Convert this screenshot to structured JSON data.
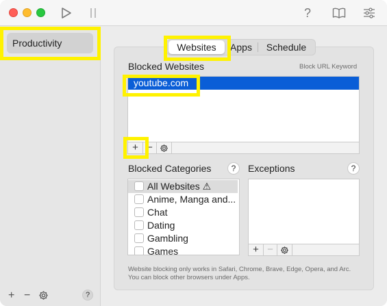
{
  "titlebar": {
    "icons": [
      "play-icon",
      "pause-icon",
      "help-icon",
      "book-icon",
      "sliders-icon"
    ],
    "help_glyph": "?"
  },
  "sidebar": {
    "items": [
      {
        "label": "Productivity"
      }
    ],
    "footer": {
      "add": "+",
      "remove": "−",
      "help": "?"
    }
  },
  "tabs": [
    {
      "label": "Websites",
      "active": true
    },
    {
      "label": "Apps",
      "active": false
    },
    {
      "label": "Schedule",
      "active": false
    }
  ],
  "blocked_websites": {
    "title": "Blocked Websites",
    "keyword_link": "Block URL Keyword",
    "items": [
      "youtube.com"
    ],
    "toolbar": {
      "add": "+",
      "remove": "−"
    }
  },
  "blocked_categories": {
    "title": "Blocked Categories",
    "help": "?",
    "items": [
      {
        "label": "All Websites ⚠",
        "checked": false
      },
      {
        "label": "Anime, Manga and...",
        "checked": false
      },
      {
        "label": "Chat",
        "checked": false
      },
      {
        "label": "Dating",
        "checked": false
      },
      {
        "label": "Gambling",
        "checked": false
      },
      {
        "label": "Games",
        "checked": false
      }
    ]
  },
  "exceptions": {
    "title": "Exceptions",
    "help": "?",
    "toolbar": {
      "add": "+",
      "remove": "−"
    }
  },
  "footnote": {
    "line1": "Website blocking only works in Safari, Chrome, Brave, Edge, Opera, and Arc.",
    "line2": "You can block other browsers under Apps."
  },
  "colors": {
    "selection": "#0a5ed7",
    "highlight": "#fff200"
  }
}
